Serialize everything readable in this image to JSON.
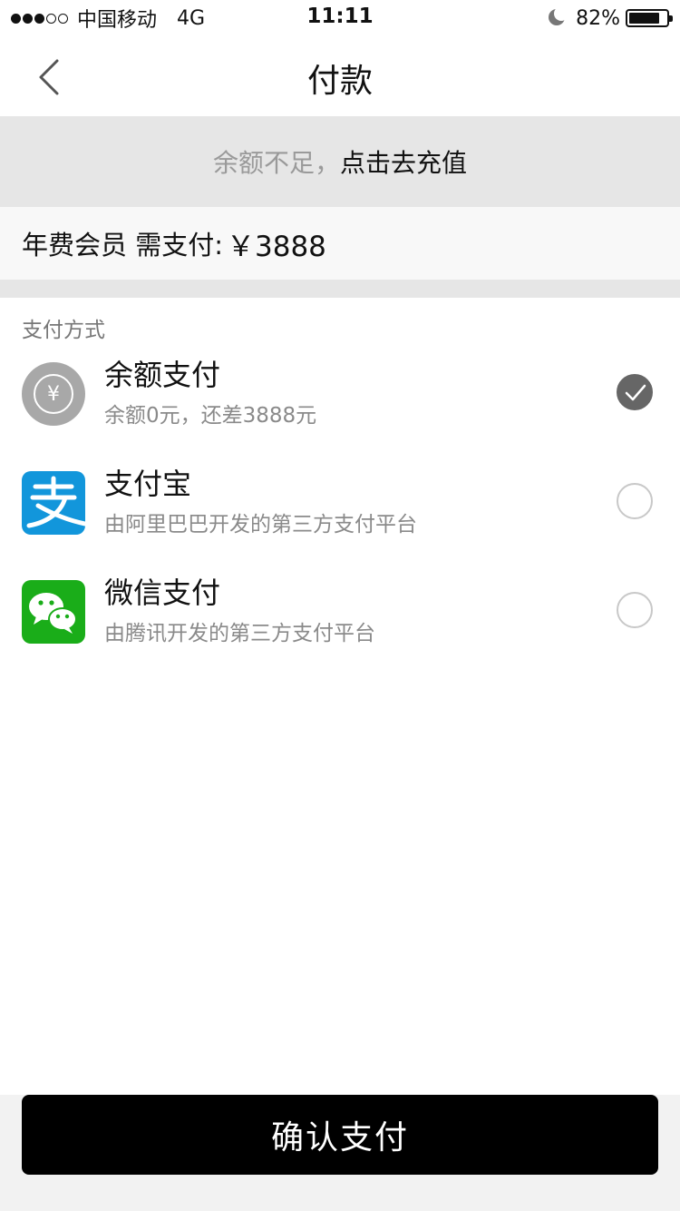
{
  "status_bar": {
    "carrier": "中国移动",
    "network": "4G",
    "time": "11:11",
    "battery_percent": "82%",
    "battery_level": 0.82,
    "signal_bars_filled": 3,
    "signal_bars_total": 5
  },
  "nav": {
    "title": "付款",
    "back_icon": "chevron-left-icon"
  },
  "recharge_banner": {
    "prefix": "余额不足，",
    "link": "点击去充值"
  },
  "amount": {
    "label": "年费会员 需支付:",
    "value": "￥3888"
  },
  "payment": {
    "section_label": "支付方式",
    "methods": [
      {
        "title": "余额支付",
        "desc": "余额0元，还差3888元",
        "icon": "yuan-coin-icon",
        "selected": true
      },
      {
        "title": "支付宝",
        "desc": "由阿里巴巴开发的第三方支付平台",
        "icon": "alipay-icon",
        "selected": false
      },
      {
        "title": "微信支付",
        "desc": "由腾讯开发的第三方支付平台",
        "icon": "wechat-icon",
        "selected": false
      }
    ]
  },
  "confirm_button": {
    "label": "确认支付"
  },
  "colors": {
    "alipay_blue": "#1296db",
    "wechat_green": "#1aad19",
    "balance_gray": "#a8a8a8",
    "button_black": "#000000",
    "banner_gray": "#e6e6e6"
  }
}
